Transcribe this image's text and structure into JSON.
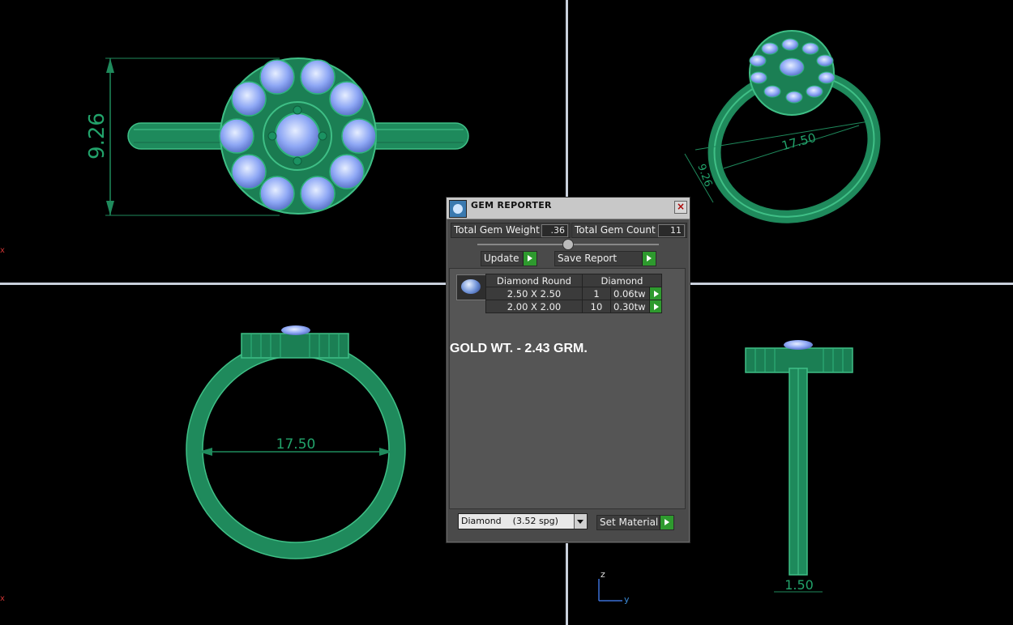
{
  "viewports": {
    "top_left": {
      "dimension_label": "9.26"
    },
    "top_right": {
      "dimension_label_a": "17.50",
      "dimension_label_b": "9.26"
    },
    "bottom_left": {
      "dimension_label": "17.50"
    },
    "bottom_right": {
      "dimension_label": "1.50"
    },
    "axis": {
      "z_label": "z",
      "y_label": "y"
    },
    "marker_left_top": "x",
    "marker_left_bottom": "x"
  },
  "colors": {
    "ring": "#1f8a5c",
    "gem": "#8fb0ff",
    "viewport_border": "#c9d0dc",
    "accent_button": "#2e9a2e"
  },
  "gem_reporter": {
    "title": "GEM REPORTER",
    "close_icon": "close-icon",
    "total_gem_weight_label": "Total Gem Weight",
    "total_gem_weight_value": ".36",
    "total_gem_count_label": "Total Gem Count",
    "total_gem_count_value": "11",
    "update_label": "Update",
    "save_report_label": "Save Report",
    "table": {
      "headers": [
        "Diamond Round",
        "Diamond"
      ],
      "rows": [
        {
          "size": "2.50 X 2.50",
          "count": "1",
          "weight": "0.06tw"
        },
        {
          "size": "2.00 X 2.00",
          "count": "10",
          "weight": "0.30tw"
        }
      ]
    },
    "note": "GOLD WT. - 2.43 GRM.",
    "material_select_value": "Diamond",
    "material_select_detail": "(3.52 spg)",
    "set_material_label": "Set Material"
  }
}
